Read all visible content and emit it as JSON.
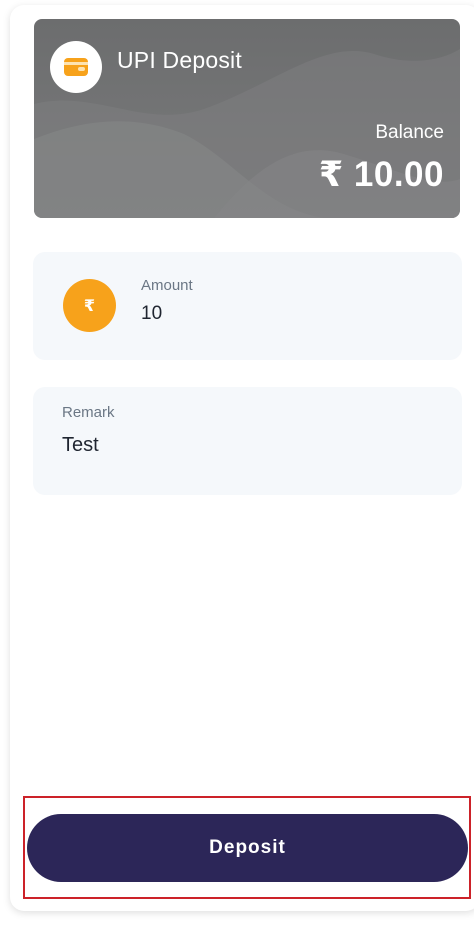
{
  "card": {
    "title": "UPI Deposit",
    "icon": "wallet-icon",
    "balance_label": "Balance",
    "balance_value": "₹ 10.00"
  },
  "amount": {
    "icon": "rupee-icon",
    "icon_glyph": "₹",
    "label": "Amount",
    "value": "10"
  },
  "remark": {
    "label": "Remark",
    "value": "Test"
  },
  "deposit_button": {
    "label": "Deposit"
  },
  "colors": {
    "card_bg": "#6c6d6e",
    "accent_orange": "#f7a21b",
    "button_bg": "#2c2658",
    "highlight_border": "#cc2229",
    "field_bg": "#f5f8fb"
  }
}
